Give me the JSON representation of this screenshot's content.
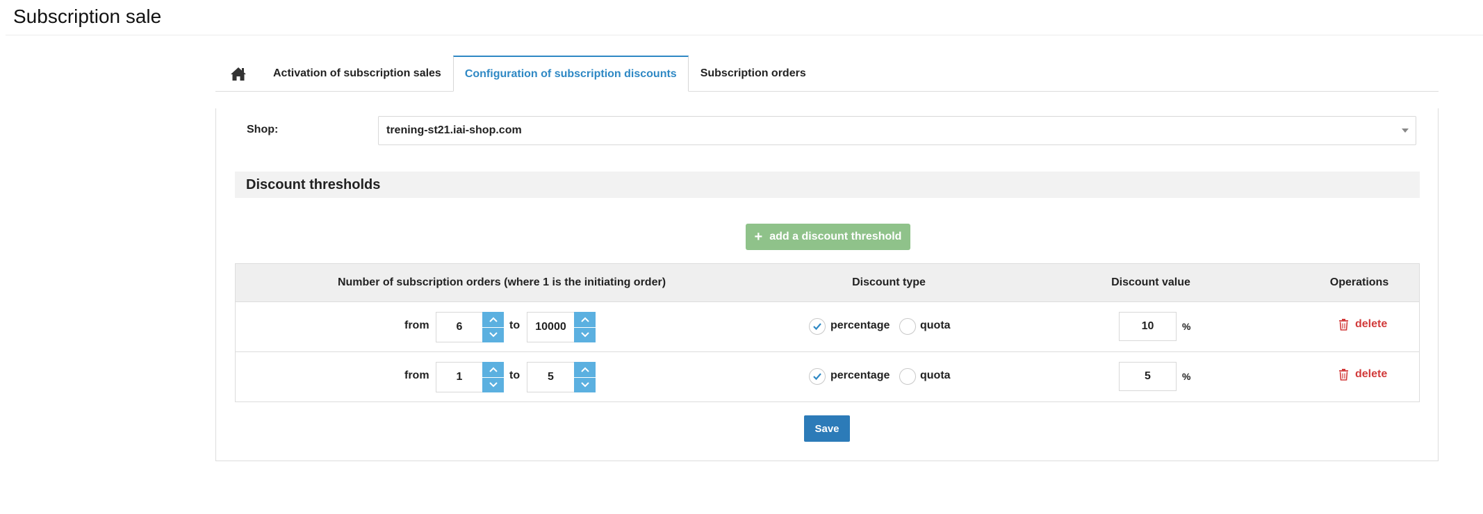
{
  "page": {
    "title": "Subscription sale"
  },
  "tabs": [
    {
      "id": "home",
      "label": "",
      "icon": "home-icon"
    },
    {
      "id": "activation",
      "label": "Activation of subscription sales"
    },
    {
      "id": "configuration",
      "label": "Configuration of subscription discounts",
      "active": true
    },
    {
      "id": "orders",
      "label": "Subscription orders"
    }
  ],
  "shop": {
    "label": "Shop:",
    "value": "trening-st21.iai-shop.com"
  },
  "section": {
    "title": "Discount thresholds"
  },
  "add_button": {
    "label": "add a discount threshold"
  },
  "table": {
    "headers": {
      "orders": "Number of subscription orders (where 1 is the initiating order)",
      "type": "Discount type",
      "value": "Discount value",
      "ops": "Operations"
    },
    "from_label": "from",
    "to_label": "to",
    "type_options": [
      "percentage",
      "quota"
    ],
    "unit": "%",
    "delete_label": "delete",
    "rows": [
      {
        "from": "6",
        "to": "10000",
        "type": "percentage",
        "value": "10"
      },
      {
        "from": "1",
        "to": "5",
        "type": "percentage",
        "value": "5"
      }
    ]
  },
  "save_button": {
    "label": "Save"
  },
  "colors": {
    "accent": "#2e88c4",
    "spinner": "#5bb0e0",
    "add": "#8fc28a",
    "save": "#2c7bb8",
    "delete": "#d23b3b"
  }
}
